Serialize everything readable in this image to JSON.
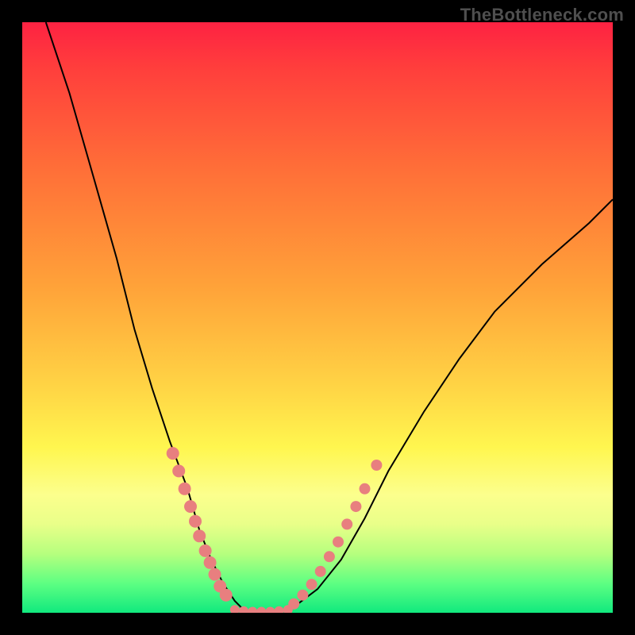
{
  "watermark": "TheBottleneck.com",
  "chart_data": {
    "type": "line",
    "title": "",
    "xlabel": "",
    "ylabel": "",
    "xlim": [
      0,
      100
    ],
    "ylim": [
      0,
      100
    ],
    "grid": false,
    "legend": false,
    "series": [
      {
        "name": "bottleneck-curve",
        "x": [
          4,
          8,
          12,
          16,
          19,
          22,
          25,
          28,
          30,
          32,
          34,
          36,
          38,
          42,
          46,
          50,
          54,
          58,
          62,
          68,
          74,
          80,
          88,
          96,
          100
        ],
        "y": [
          100,
          88,
          74,
          60,
          48,
          38,
          29,
          21,
          14,
          9,
          5,
          2,
          0,
          0,
          1,
          4,
          9,
          16,
          24,
          34,
          43,
          51,
          59,
          66,
          70
        ]
      }
    ],
    "markers_left": [
      {
        "x": 25.5,
        "y": 27
      },
      {
        "x": 26.5,
        "y": 24
      },
      {
        "x": 27.5,
        "y": 21
      },
      {
        "x": 28.5,
        "y": 18
      },
      {
        "x": 29.3,
        "y": 15.5
      },
      {
        "x": 30.0,
        "y": 13
      },
      {
        "x": 31.0,
        "y": 10.5
      },
      {
        "x": 31.8,
        "y": 8.5
      },
      {
        "x": 32.6,
        "y": 6.5
      },
      {
        "x": 33.5,
        "y": 4.5
      },
      {
        "x": 34.5,
        "y": 3
      }
    ],
    "markers_right": [
      {
        "x": 46,
        "y": 1.5
      },
      {
        "x": 47.5,
        "y": 3
      },
      {
        "x": 49,
        "y": 4.8
      },
      {
        "x": 50.5,
        "y": 7
      },
      {
        "x": 52,
        "y": 9.5
      },
      {
        "x": 53.5,
        "y": 12
      },
      {
        "x": 55,
        "y": 15
      },
      {
        "x": 56.5,
        "y": 18
      },
      {
        "x": 58,
        "y": 21
      },
      {
        "x": 60,
        "y": 25
      }
    ],
    "floor_markers": [
      {
        "x": 36,
        "y": 0.5
      },
      {
        "x": 37.5,
        "y": 0.3
      },
      {
        "x": 39,
        "y": 0.2
      },
      {
        "x": 40.5,
        "y": 0.2
      },
      {
        "x": 42,
        "y": 0.2
      },
      {
        "x": 43.5,
        "y": 0.3
      },
      {
        "x": 45,
        "y": 0.5
      }
    ],
    "colors": {
      "gradient_top": "#fe2242",
      "gradient_bottom": "#11e97e",
      "curve": "#000000",
      "markers": "#e87f7f"
    }
  }
}
